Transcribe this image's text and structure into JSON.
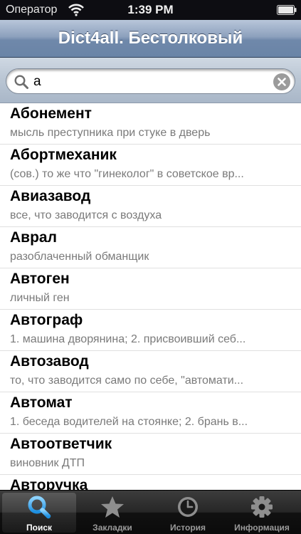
{
  "status_bar": {
    "carrier": "Оператор",
    "time": "1:39 PM"
  },
  "nav": {
    "title": "Dict4all. Бестолковый"
  },
  "search": {
    "value": "а"
  },
  "entries": [
    {
      "word": "Абонемент",
      "definition": "мысль преступника при стуке в дверь"
    },
    {
      "word": "Абортмеханик",
      "definition": "(сов.) то же что \"гинеколог\" в советское вр..."
    },
    {
      "word": "Авиазавод",
      "definition": "все, что заводится с воздуха"
    },
    {
      "word": "Аврал",
      "definition": "разоблаченный обманщик"
    },
    {
      "word": "Автоген",
      "definition": "личный ген"
    },
    {
      "word": "Автограф",
      "definition": "1. машина дворянина; 2. присвоивший себ..."
    },
    {
      "word": "Автозавод",
      "definition": "то, что заводится само по себе, \"автомати..."
    },
    {
      "word": "Автомат",
      "definition": "1. беседа водителей на стоянке; 2. брань в..."
    },
    {
      "word": "Автоответчик",
      "definition": "виновник ДТП"
    },
    {
      "word": "Авторучка",
      "definition": ""
    }
  ],
  "tabs": [
    {
      "label": "Поиск",
      "icon": "magnifier-icon",
      "active": true
    },
    {
      "label": "Закладки",
      "icon": "star-icon",
      "active": false
    },
    {
      "label": "История",
      "icon": "clock-icon",
      "active": false
    },
    {
      "label": "Информация",
      "icon": "gear-icon",
      "active": false
    }
  ],
  "colors": {
    "active_tab_icon": "#35a8f0",
    "inactive_tab_icon": "#9a9a9a",
    "nav_bar": "#7d93b2"
  }
}
